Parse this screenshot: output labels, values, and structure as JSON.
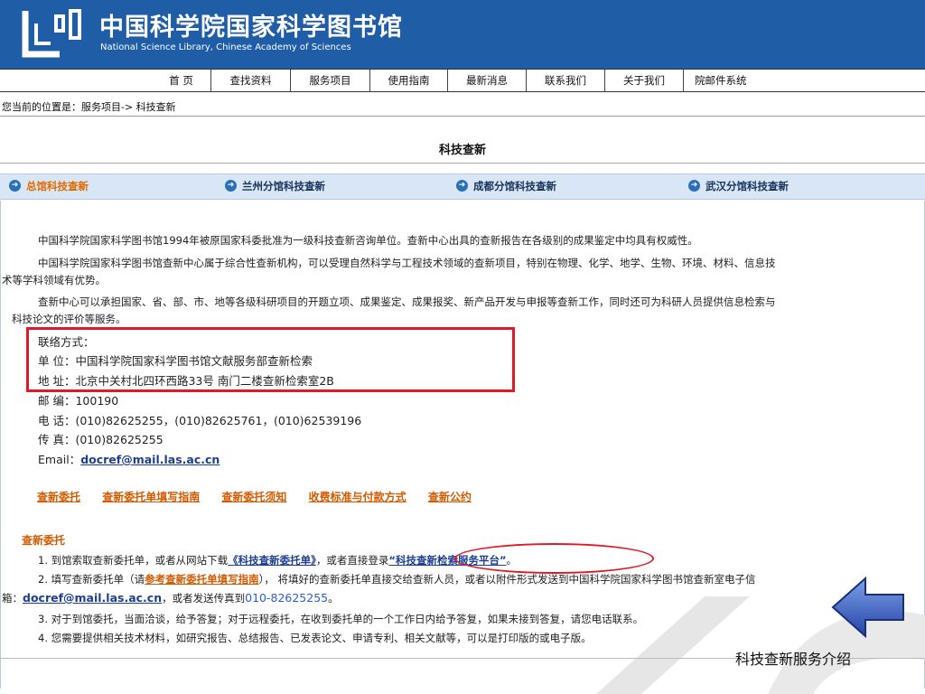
{
  "header": {
    "title_cn": "中国科学院国家科学图书馆",
    "title_en": "National Science Library, Chinese Academy of Sciences"
  },
  "nav": {
    "items": [
      "首 页",
      "查找资料",
      "服务项目",
      "使用指南",
      "最新消息",
      "联系我们",
      "关于我们",
      "院邮件系统"
    ]
  },
  "breadcrumb": "您当前的位置是：服务项目-> 科技查新",
  "page_title": "科技查新",
  "tabs": [
    {
      "label": "总馆科技查新",
      "active": true
    },
    {
      "label": "兰州分馆科技查新",
      "active": false
    },
    {
      "label": "成都分馆科技查新",
      "active": false
    },
    {
      "label": "武汉分馆科技查新",
      "active": false
    }
  ],
  "intro": {
    "p1": "中国科学院国家科学图书馆1994年被原国家科委批准为一级科技查新咨询单位。查新中心出具的查新报告在各级别的成果鉴定中均具有权威性。",
    "p2_line1": "中国科学院国家科学图书馆查新中心属于综合性查新机构，可以受理自然科学与工程技术领域的查新项目，特别在物理、化学、地学、生物、环境、材料、信息技",
    "p2_line2": "术等学科领域有优势。",
    "p3_line1": "查新中心可以承担国家、省、部、市、地等各级科研项目的开题立项、成果鉴定、成果报奖、新产品开发与申报等查新工作，同时还可为科研人员提供信息检索与",
    "p3_line2": "科技论文的评价等服务。"
  },
  "contact": {
    "heading": "联络方式：",
    "unit": "单 位：中国科学院国家科学图书馆文献服务部查新检索",
    "address": "地 址：北京中关村北四环西路33号 南门二楼查新检索室2B",
    "postcode": "邮 编：100190",
    "phone": "电 话：(010)82625255，(010)82625761，(010)62539196",
    "fax": "传 真：(010)82625255",
    "email_label": "Email：",
    "email": "docref@mail.las.ac.cn"
  },
  "links": [
    "查新委托",
    "查新委托单填写指南",
    "查新委托须知",
    "收费标准与付款方式",
    "查新公约"
  ],
  "commission": {
    "heading": "查新委托",
    "s1_a": "1. 到馆索取查新委托单，或者从网站下载",
    "s1_link1": "《科技查新委托单》",
    "s1_b": "，或者直接登录",
    "s1_link2": "“科技查新检索服务平台”",
    "s1_c": "。",
    "s2_a": "2. 填写查新委托单（请",
    "s2_link": "参考查新委托单填写指南",
    "s2_b": "），  将填好的查新委托单直接交给查新人员，或者以附件形式发送到中国科学院国家科学图书馆查新室电子信",
    "s2_c": "箱：",
    "s2_email": "docref@mail.las.ac.cn",
    "s2_d": "，或者发送传真到",
    "s2_fax": "010-82625255",
    "s2_e": "。",
    "s3": "3. 对于到馆委托，当面洽谈，给予答复；对于远程委托，在收到委托单的一个工作日内给予答复，如果未接到答复，请您电话联系。",
    "s4": "4. 您需要提供相关技术材料，如研究报告、总结报告、已发表论文、申请专利、相关文献等，可以是打印版的或电子版。"
  },
  "caption": "科技查新服务介绍",
  "colors": {
    "header_bg": "#1f5da6",
    "tab_bg": "#d9e6f5",
    "accent_orange": "#d25a00",
    "highlight_red": "#e0192a",
    "arrow_blue": "#2d56b8"
  },
  "icons": {
    "logo": "library-logo-icon",
    "tab_arrow": "circle-arrow-right-icon",
    "back": "arrow-left-icon"
  }
}
